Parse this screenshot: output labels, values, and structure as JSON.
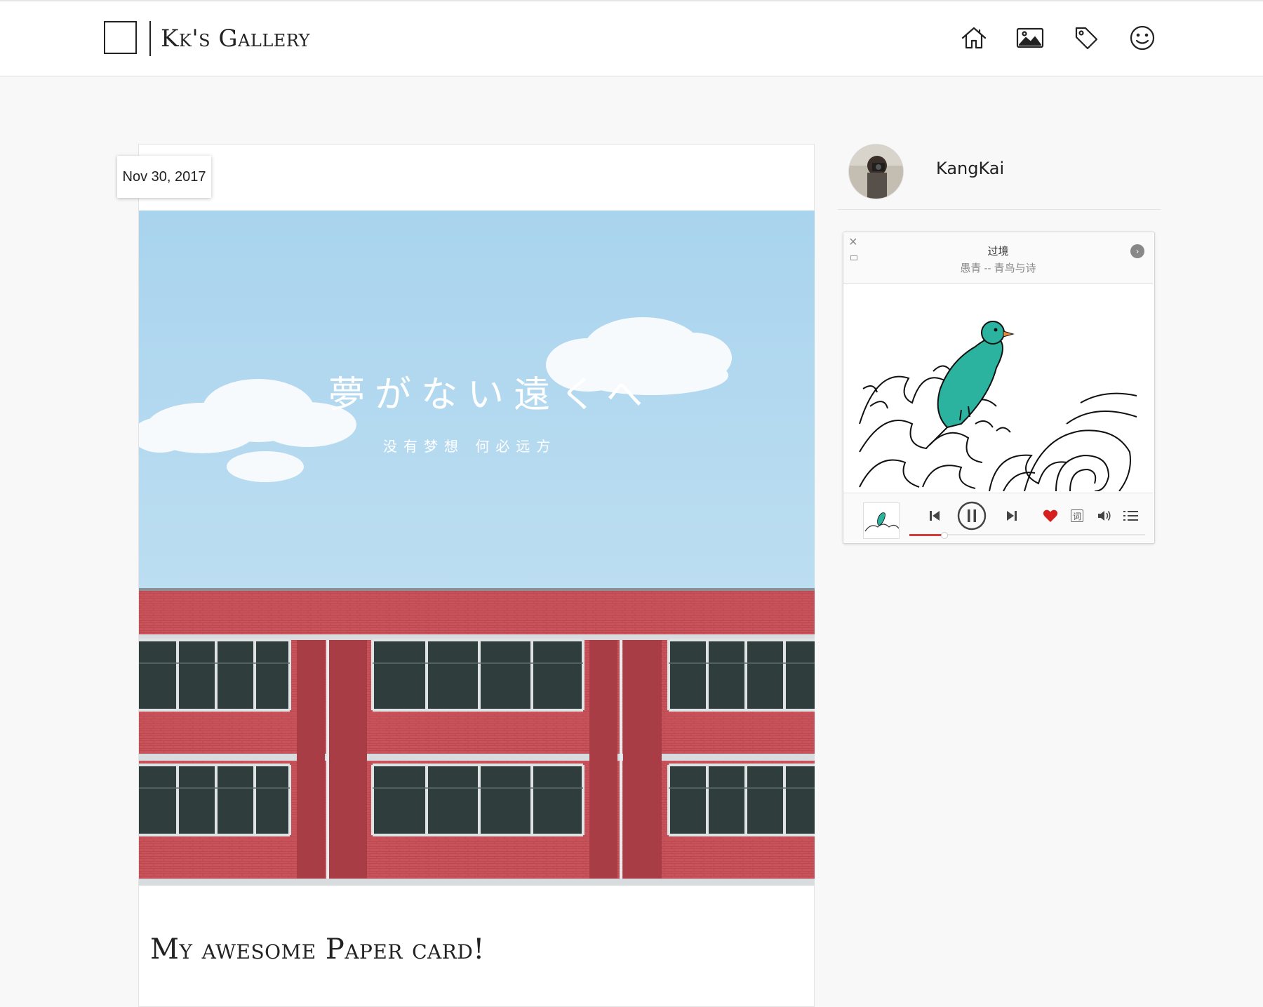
{
  "header": {
    "site_title": "Kk's Gallery",
    "nav": [
      {
        "name": "home",
        "icon": "home-icon"
      },
      {
        "name": "gallery",
        "icon": "image-icon"
      },
      {
        "name": "tags",
        "icon": "tag-icon"
      },
      {
        "name": "about",
        "icon": "smiley-icon"
      }
    ]
  },
  "post": {
    "date": "Nov 30, 2017",
    "title": "My awesome Paper card!",
    "image_caption": "夢がない遠くへ",
    "image_subcaption": "没有梦想 何必远方"
  },
  "sidebar": {
    "author": "KangKai"
  },
  "player": {
    "song": "过境",
    "artist_album": "愚青 -- 青鸟与诗",
    "progress": 0.14,
    "liked": true,
    "lyrics_label": "词",
    "close_icon": "close-icon",
    "colors": {
      "accent": "#d63b3b",
      "bird": "#2bb3a0"
    }
  }
}
